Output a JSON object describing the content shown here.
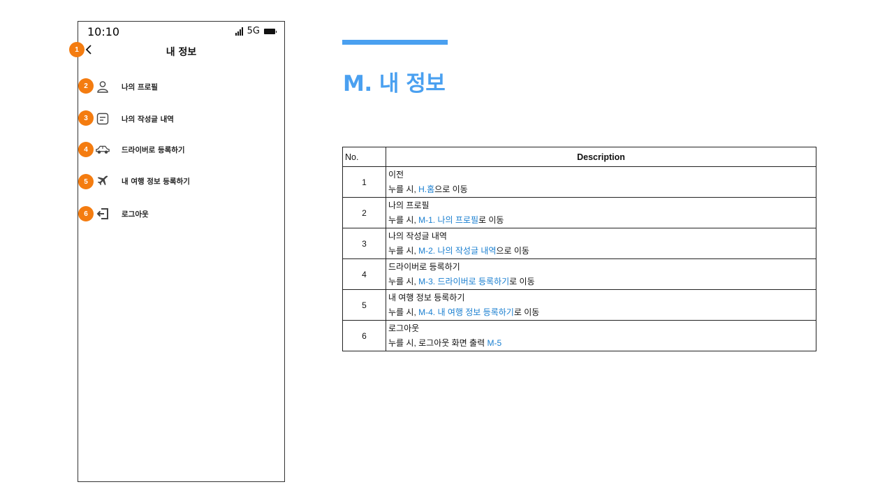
{
  "phone": {
    "status": {
      "time": "10:10",
      "network": "5G"
    },
    "header": {
      "title": "내 정보"
    },
    "menu": [
      {
        "badge": "2",
        "icon": "user-icon",
        "label": "나의 프로필"
      },
      {
        "badge": "3",
        "icon": "document-icon",
        "label": "나의 작성글 내역"
      },
      {
        "badge": "4",
        "icon": "car-icon",
        "label": "드라이버로 등록하기"
      },
      {
        "badge": "5",
        "icon": "airplane-icon",
        "label": "내 여행 정보 등록하기"
      },
      {
        "badge": "6",
        "icon": "logout-icon",
        "label": "로그아웃"
      }
    ],
    "back_badge": "1"
  },
  "section": {
    "title": "M. 내 정보"
  },
  "table": {
    "headers": {
      "no": "No.",
      "description": "Description"
    },
    "rows": [
      {
        "no": "1",
        "title": "이전",
        "prefix": "누를 시, ",
        "link": "H.홈",
        "suffix": "으로 이동"
      },
      {
        "no": "2",
        "title": "나의 프로필",
        "prefix": "누를 시, ",
        "link": "M-1. 나의 프로필",
        "suffix": "로 이동"
      },
      {
        "no": "3",
        "title": "나의 작성글 내역",
        "prefix": "누를 시, ",
        "link": "M-2. 나의 작성글 내역",
        "suffix": "으로 이동"
      },
      {
        "no": "4",
        "title": "드라이버로 등록하기",
        "prefix": "누를 시, ",
        "link": "M-3. 드라이버로 등록하기",
        "suffix": "로 이동"
      },
      {
        "no": "5",
        "title": "내 여행 정보 등록하기",
        "prefix": "누를 시, ",
        "link": "M-4. 내 여행 정보 등록하기",
        "suffix": "로 이동"
      },
      {
        "no": "6",
        "title": "로그아웃",
        "prefix": "누를 시, 로그아웃 화면 출력 ",
        "link": "M-5",
        "suffix": ""
      }
    ]
  },
  "colors": {
    "accent": "#4aa0f0",
    "badge": "#f47c10",
    "link": "#1a7fd0"
  }
}
